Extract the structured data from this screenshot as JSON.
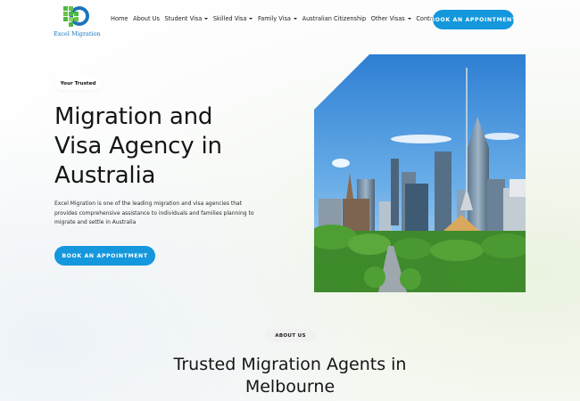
{
  "brand": {
    "logo_text": "Excel Migration",
    "colors": {
      "accent": "#1497dc",
      "logo_blue": "#1b75bc",
      "logo_green": "#4fb848"
    }
  },
  "nav": {
    "items": [
      {
        "label": "Home",
        "has_dropdown": false
      },
      {
        "label": "About Us",
        "has_dropdown": false
      },
      {
        "label": "Student Visa",
        "has_dropdown": true
      },
      {
        "label": "Skilled Visa",
        "has_dropdown": true
      },
      {
        "label": "Family Visa",
        "has_dropdown": true
      },
      {
        "label": "Australian Citizenship",
        "has_dropdown": false
      },
      {
        "label": "Other Visas",
        "has_dropdown": true
      },
      {
        "label": "Contact Us",
        "has_dropdown": false
      }
    ],
    "cta_label": "BOOK AN APPOINTMENT"
  },
  "hero": {
    "badge": "Your Trusted",
    "title_line1": "Migration and",
    "title_line2": "Visa Agency in",
    "title_line3": "Australia",
    "description": "Excel Migration is one of the leading migration and visa agencies that provides comprehensive assistance to individuals and families planning to migrate and settle in Australia",
    "cta_label": "BOOK AN APPOINTMENT",
    "image_icon": "melbourne-skyline-photo"
  },
  "about": {
    "badge": "ABOUT US",
    "title_line1": "Trusted Migration Agents in",
    "title_line2": "Melbourne"
  }
}
